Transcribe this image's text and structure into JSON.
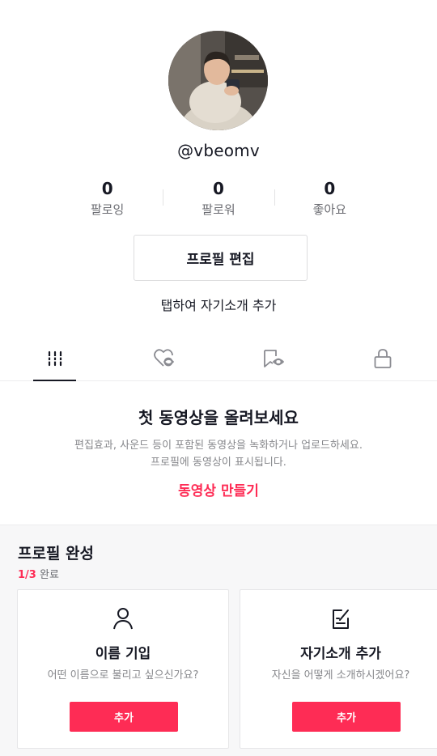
{
  "profile": {
    "username": "@vbeomv",
    "avatar_icon": "profile-photo"
  },
  "stats": [
    {
      "value": "0",
      "label": "팔로잉"
    },
    {
      "value": "0",
      "label": "팔로워"
    },
    {
      "value": "0",
      "label": "좋아요"
    }
  ],
  "actions": {
    "edit_profile_label": "프로필 편집",
    "add_bio_label": "탭하여 자기소개 추가"
  },
  "tabs": [
    {
      "icon": "grid-videos-icon",
      "active": true
    },
    {
      "icon": "liked-heart-icon",
      "active": false
    },
    {
      "icon": "favorites-bookmark-icon",
      "active": false
    },
    {
      "icon": "private-lock-icon",
      "active": false
    }
  ],
  "empty_state": {
    "title": "첫 동영상을 올려보세요",
    "desc_line1": "편집효과, 사운드 등이 포함된 동영상을 녹화하거나 업로드하세요.",
    "desc_line2": "프로필에 동영상이 표시됩니다.",
    "cta_label": "동영상 만들기"
  },
  "profile_completion": {
    "title": "프로필 완성",
    "progress_done": "1/3",
    "progress_label": "완료",
    "cards": [
      {
        "icon": "person-icon",
        "title": "이름 기입",
        "desc": "어떤 이름으로 불리고 싶으신가요?",
        "button": "추가"
      },
      {
        "icon": "edit-note-icon",
        "title": "자기소개 추가",
        "desc": "자신을 어떻게 소개하시겠어요?",
        "button": "추가"
      }
    ]
  },
  "colors": {
    "accent": "#fe2c55",
    "text": "#161823",
    "muted": "#86878b"
  }
}
